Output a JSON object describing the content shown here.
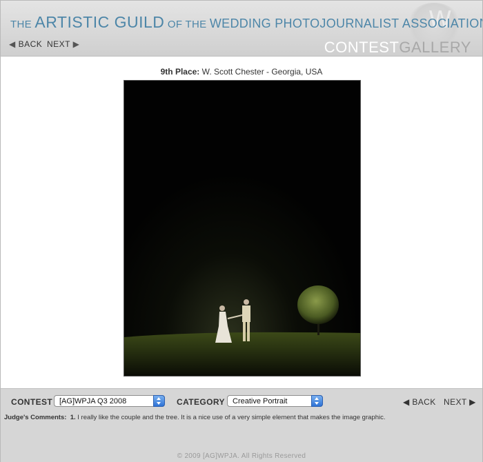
{
  "header": {
    "banner": {
      "the": "THE",
      "artistic_guild": "ARTISTIC GUILD",
      "of_the": "OF THE",
      "wedding_photojournalist": "WEDDING PHOTOJOURNALIST",
      "association": "ASSOCIATION"
    },
    "seal_letter": "W",
    "back_label": "BACK",
    "next_label": "NEXT",
    "gallery_title_part1": "CONTEST",
    "gallery_title_part2": "GALLERY"
  },
  "photo": {
    "place": "9th Place:",
    "photographer": "W. Scott Chester - Georgia, USA"
  },
  "controls": {
    "contest_label": "CONTEST",
    "contest_value": "[AG]WPJA Q3 2008",
    "category_label": "CATEGORY",
    "category_value": "Creative Portrait",
    "back_label": "BACK",
    "next_label": "NEXT"
  },
  "comments": {
    "heading": "Judge's Comments:",
    "number": "1.",
    "text": "I really like the couple and the tree. It is a nice use of a very simple element that makes the image graphic."
  },
  "footer": {
    "copyright": "© 2009 [AG]WPJA. All Rights Reserved"
  },
  "colors": {
    "banner_blue": "#4d86a8",
    "header_gray": "#d6d6d6",
    "select_blue": "#2f73d6"
  }
}
